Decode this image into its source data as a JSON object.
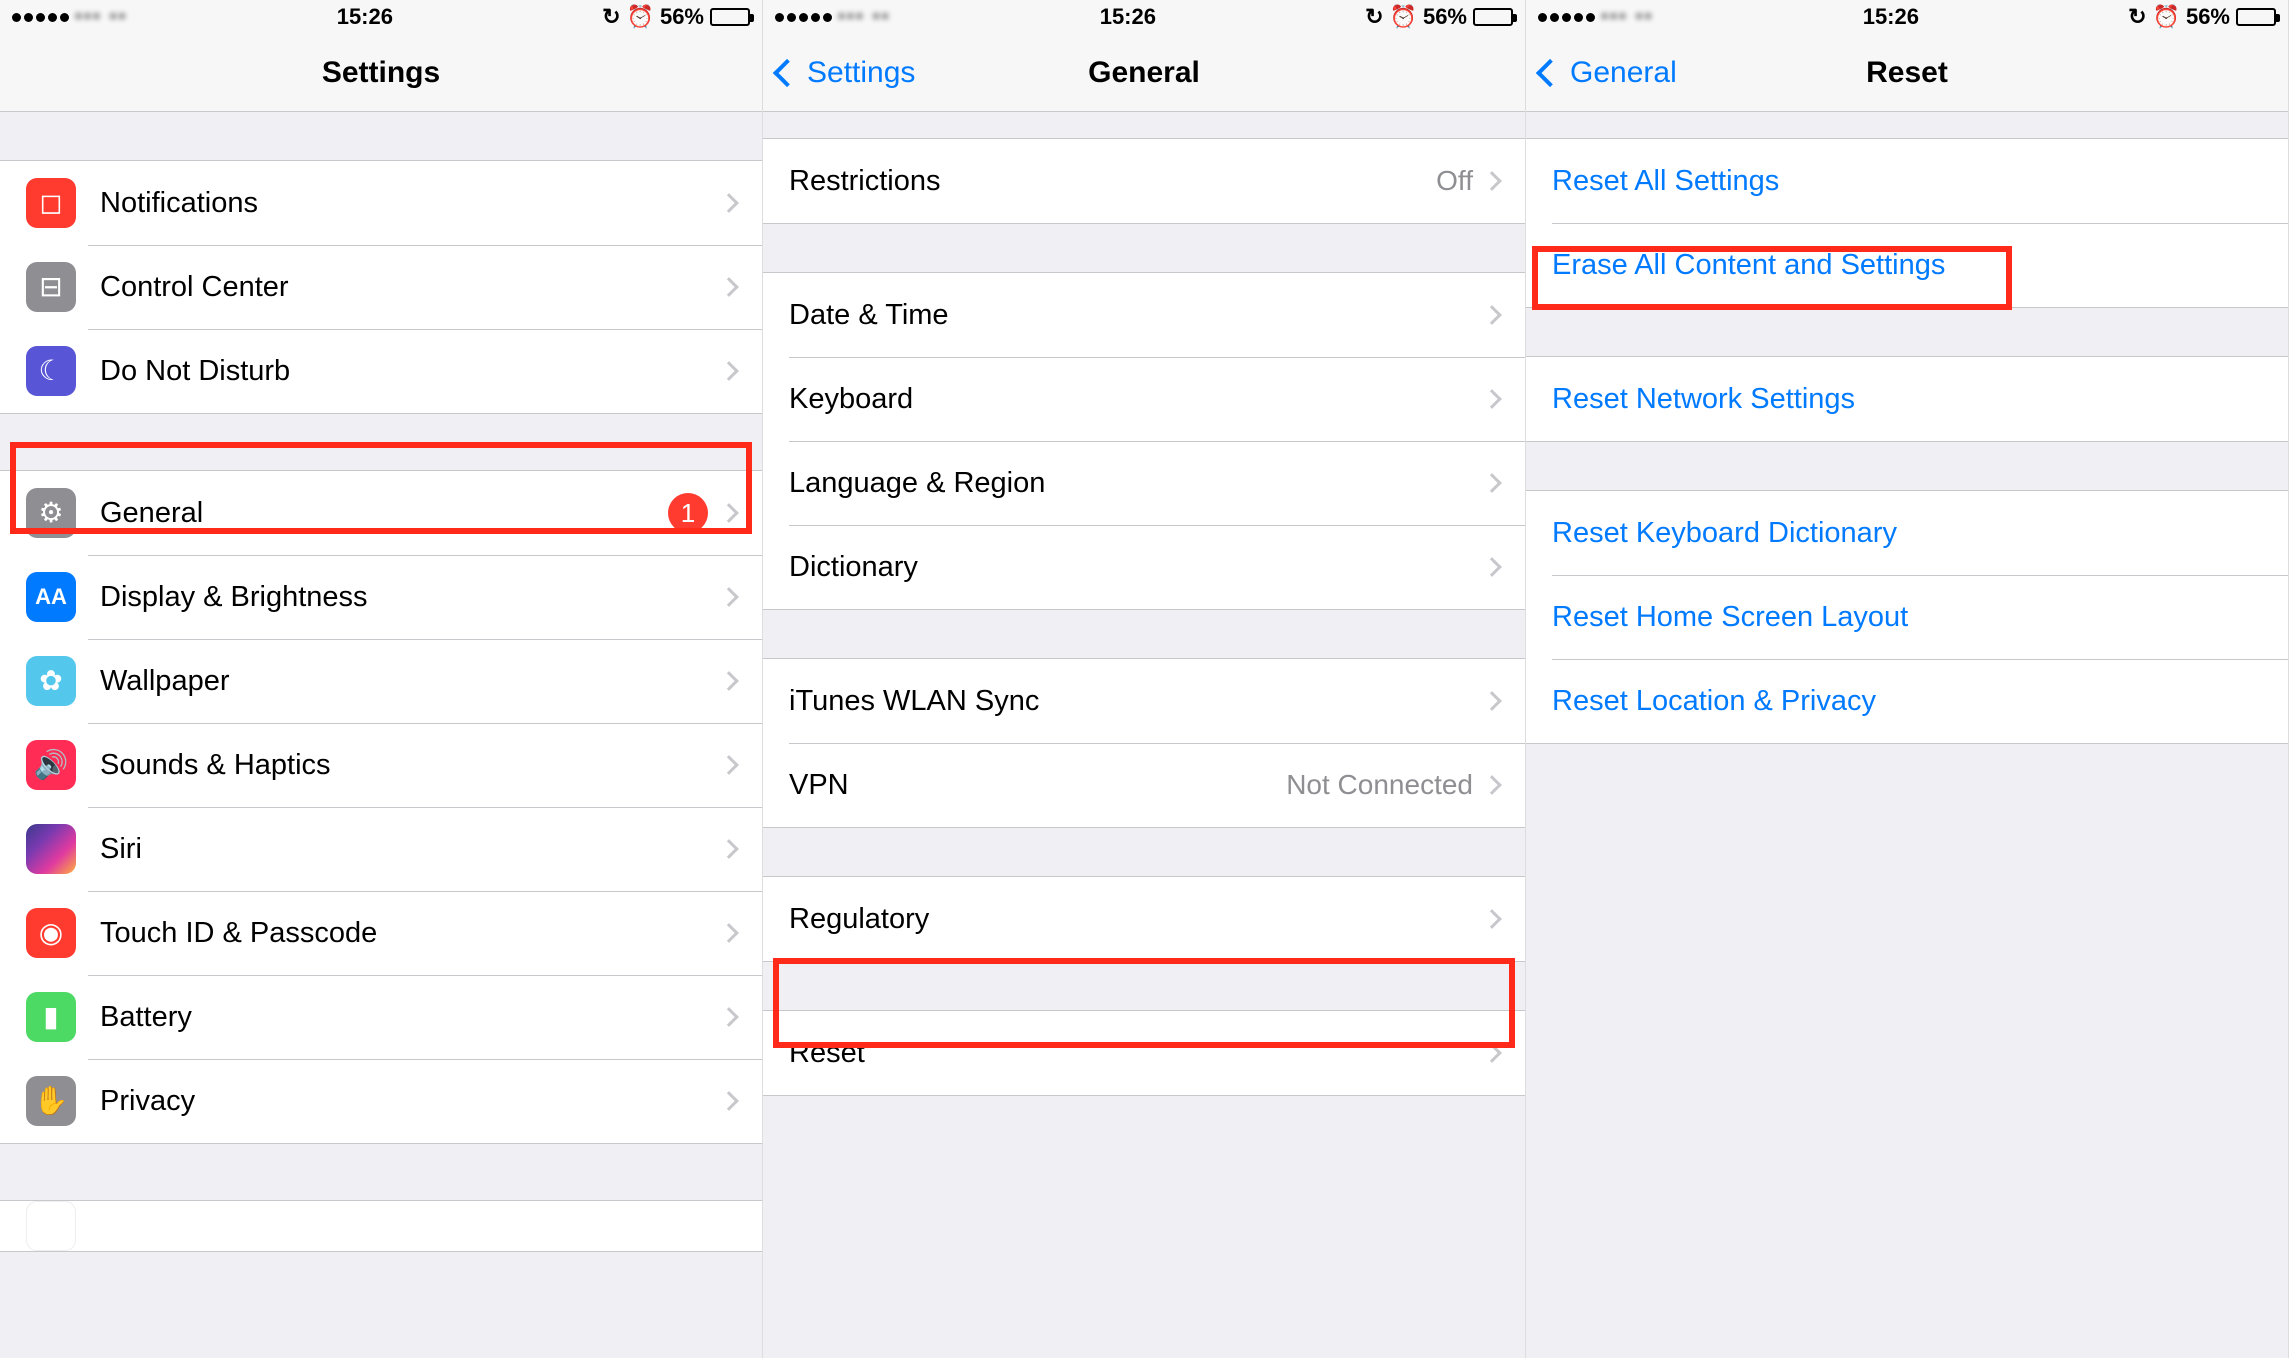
{
  "status": {
    "time": "15:26",
    "battery_pct": "56%",
    "lock_glyph": "⟳",
    "alarm_glyph": "⏰"
  },
  "screen1": {
    "title": "Settings",
    "rows": {
      "notifications": "Notifications",
      "control_center": "Control Center",
      "dnd": "Do Not Disturb",
      "general": "General",
      "general_badge": "1",
      "display": "Display & Brightness",
      "wallpaper": "Wallpaper",
      "sounds": "Sounds & Haptics",
      "siri": "Siri",
      "touchid": "Touch ID & Passcode",
      "battery": "Battery",
      "privacy": "Privacy"
    }
  },
  "screen2": {
    "back": "Settings",
    "title": "General",
    "rows": {
      "restrictions": "Restrictions",
      "restrictions_detail": "Off",
      "date_time": "Date & Time",
      "keyboard": "Keyboard",
      "lang_region": "Language & Region",
      "dictionary": "Dictionary",
      "itunes_sync": "iTunes WLAN Sync",
      "vpn": "VPN",
      "vpn_detail": "Not Connected",
      "regulatory": "Regulatory",
      "reset": "Reset"
    }
  },
  "screen3": {
    "back": "General",
    "title": "Reset",
    "rows": {
      "reset_all": "Reset All Settings",
      "erase_all": "Erase All Content and Settings",
      "reset_network": "Reset Network Settings",
      "reset_keyboard": "Reset Keyboard Dictionary",
      "reset_home": "Reset Home Screen Layout",
      "reset_location": "Reset Location & Privacy"
    }
  }
}
